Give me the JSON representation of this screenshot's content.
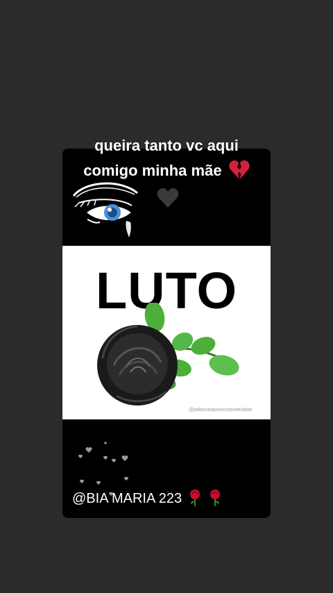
{
  "story": {
    "caption_line1": "queira tanto vc aqui",
    "caption_line2": "comigo minha mãe",
    "caption_emoji": "broken-heart-icon",
    "sticker_emoji": "black-heart-icon",
    "eye_sticker": "crying-eye-icon",
    "panel_title": "LUTO",
    "watermark": "@palavrasqueocorpodesaber",
    "signature_text": "@BIA MARIA 223",
    "signature_emojis": [
      "rose-icon",
      "rose-icon"
    ]
  },
  "colors": {
    "background": "#2b2b2b",
    "card": "#000000",
    "panel": "#ffffff",
    "accent_red": "#d4213a"
  }
}
